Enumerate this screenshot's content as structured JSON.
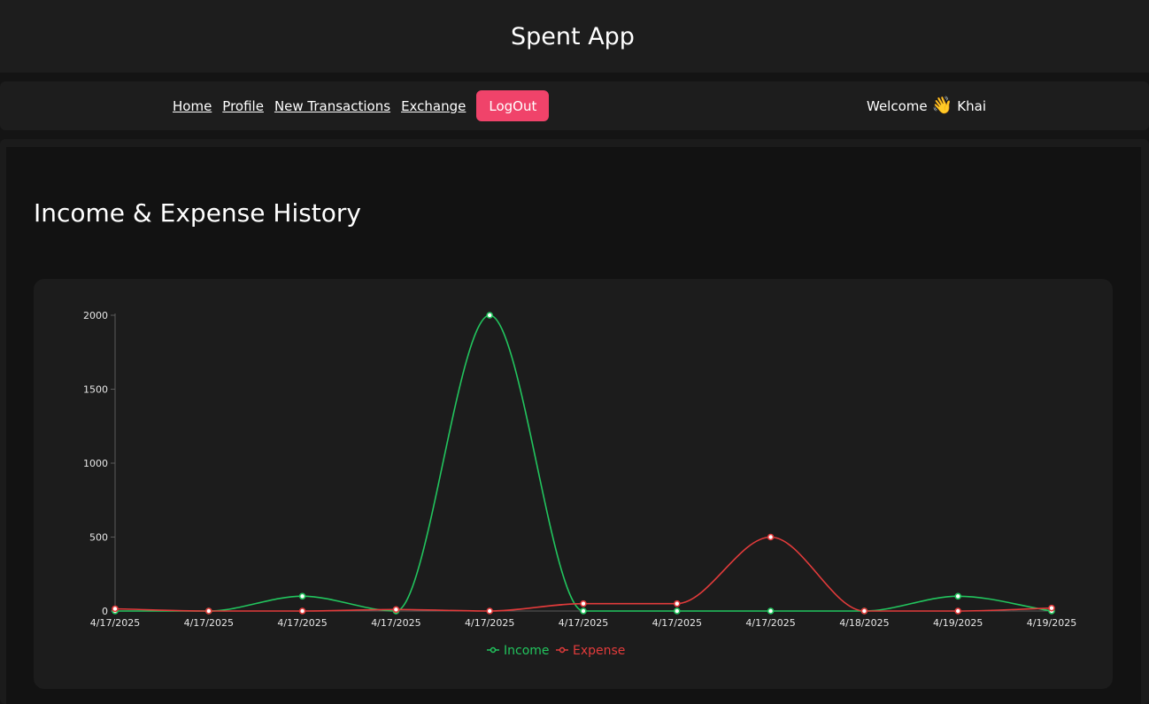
{
  "app": {
    "title": "Spent App"
  },
  "nav": {
    "links": [
      "Home",
      "Profile",
      "New Transactions",
      "Exchange"
    ],
    "logout_label": "LogOut",
    "welcome_prefix": "Welcome",
    "wave_emoji": "👋",
    "user_name": "Khai"
  },
  "page": {
    "title": "Income & Expense History"
  },
  "colors": {
    "income": "#22c55e",
    "expense": "#e23b3b",
    "accent": "#f0436a"
  },
  "chart_data": {
    "type": "line",
    "categories": [
      "4/17/2025",
      "4/17/2025",
      "4/17/2025",
      "4/17/2025",
      "4/17/2025",
      "4/17/2025",
      "4/17/2025",
      "4/17/2025",
      "4/18/2025",
      "4/19/2025",
      "4/19/2025"
    ],
    "series": [
      {
        "name": "Income",
        "values": [
          0,
          0,
          100,
          0,
          2000,
          0,
          0,
          0,
          0,
          100,
          0
        ]
      },
      {
        "name": "Expense",
        "values": [
          15,
          0,
          0,
          10,
          0,
          50,
          50,
          500,
          0,
          0,
          20
        ]
      }
    ],
    "yticks": [
      0,
      500,
      1000,
      1500,
      2000
    ],
    "ylim": [
      0,
      2000
    ],
    "smooth": true,
    "legend_position": "bottom-center",
    "grid": false
  }
}
